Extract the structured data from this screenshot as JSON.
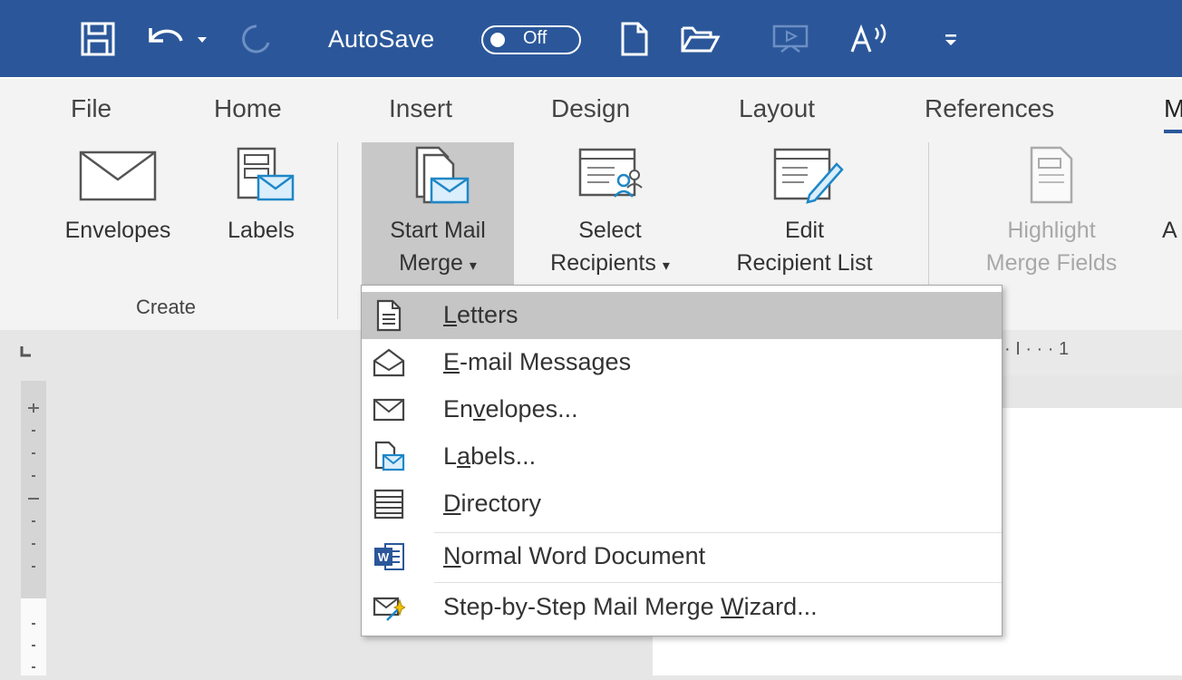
{
  "qat": {
    "autosave_label": "AutoSave",
    "autosave_state": "Off"
  },
  "tabs": [
    "File",
    "Home",
    "Insert",
    "Design",
    "Layout",
    "References",
    "M"
  ],
  "ribbon": {
    "envelopes": "Envelopes",
    "labels": "Labels",
    "start_mail_merge_line1": "Start Mail",
    "start_mail_merge_line2": "Merge",
    "select_recipients_line1": "Select",
    "select_recipients_line2": "Recipients",
    "edit_recipient_list_line1": "Edit",
    "edit_recipient_list_line2": "Recipient List",
    "highlight_line1": "Highlight",
    "highlight_line2": "Merge Fields",
    "cut_off_letter": "A",
    "group_create": "Create"
  },
  "ruler": {
    "marks": "· I · · · 1"
  },
  "menu": {
    "items": [
      {
        "label": "Letters",
        "accel": "L",
        "icon": "document-icon",
        "selected": true
      },
      {
        "label": "E-mail Messages",
        "accel": "E",
        "icon": "email-message-icon",
        "selected": false
      },
      {
        "label": "Envelopes...",
        "accel": "v",
        "icon": "envelope-icon",
        "selected": false
      },
      {
        "label": "Labels...",
        "accel": "a",
        "icon": "labels-icon",
        "selected": false
      },
      {
        "label": "Directory",
        "accel": "D",
        "icon": "directory-icon",
        "selected": false
      },
      {
        "label": "Normal Word Document",
        "accel": "N",
        "icon": "word-document-icon",
        "selected": false
      },
      {
        "label": "Step-by-Step Mail Merge Wizard...",
        "accel": "W",
        "icon": "wizard-icon",
        "selected": false
      }
    ]
  }
}
